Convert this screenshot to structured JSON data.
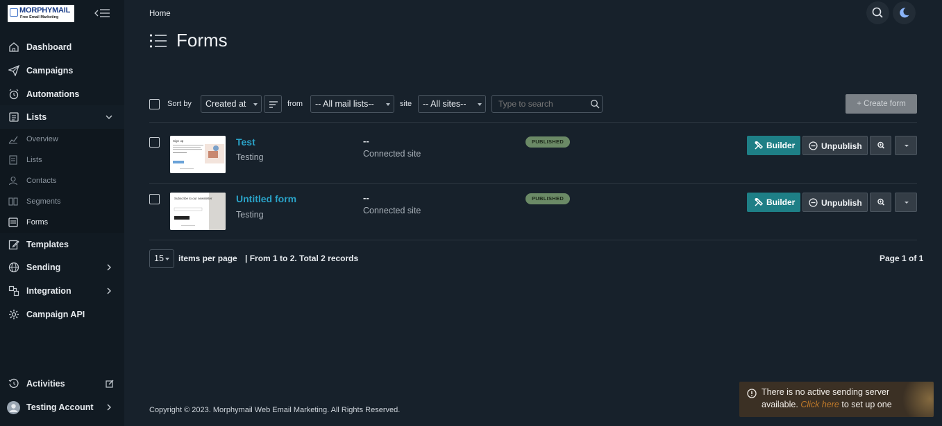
{
  "app": {
    "logo_title": "MORPHYMAIL",
    "logo_subtitle": "Free Email Marketing"
  },
  "sidebar": {
    "items": [
      {
        "label": "Dashboard",
        "icon": "home-icon"
      },
      {
        "label": "Campaigns",
        "icon": "paper-plane-icon"
      },
      {
        "label": "Automations",
        "icon": "alarm-clock-icon"
      },
      {
        "label": "Lists",
        "icon": "list-icon"
      },
      {
        "label": "Templates",
        "icon": "edit-icon"
      },
      {
        "label": "Sending",
        "icon": "globe-icon"
      },
      {
        "label": "Integration",
        "icon": "plug-icon"
      },
      {
        "label": "Campaign API",
        "icon": "gear-icon"
      }
    ],
    "lists_sub": [
      {
        "label": "Overview",
        "icon": "chart-icon"
      },
      {
        "label": "Lists",
        "icon": "list-icon"
      },
      {
        "label": "Contacts",
        "icon": "user-icon"
      },
      {
        "label": "Segments",
        "icon": "segments-icon"
      },
      {
        "label": "Forms",
        "icon": "form-icon",
        "active": true
      }
    ],
    "bottom": [
      {
        "label": "Activities",
        "icon": "history-icon"
      },
      {
        "label": "Testing Account",
        "icon": "avatar"
      }
    ]
  },
  "header": {
    "breadcrumb": "Home",
    "title": "Forms"
  },
  "toolbar": {
    "sort_by_label": "Sort by",
    "sort_value": "Created at",
    "from_label": "from",
    "mail_list_value": "-- All mail lists--",
    "site_label": "site",
    "site_value": "-- All sites--",
    "search_placeholder": "Type to search",
    "create_label": "+ Create form"
  },
  "forms": [
    {
      "name": "Test",
      "list": "Testing",
      "site": "--",
      "site_caption": "Connected site",
      "status": "PUBLISHED",
      "builder_label": "Builder",
      "unpublish_label": "Unpublish",
      "thumb_heading": "Sign up"
    },
    {
      "name": "Untitled form",
      "list": "Testing",
      "site": "--",
      "site_caption": "Connected site",
      "status": "PUBLISHED",
      "builder_label": "Builder",
      "unpublish_label": "Unpublish",
      "thumb_heading": "Subscribe to our newsletter"
    }
  ],
  "pagination": {
    "per_page": "15",
    "per_page_label": "items per page",
    "range_text": "| From 1 to 2. Total 2 records",
    "page_text": "Page 1 of 1"
  },
  "footer": {
    "copyright": "Copyright © 2023. Morphymail Web Email Marketing. All Rights Reserved."
  },
  "toast": {
    "line1": "There is no active sending server",
    "line2_prefix": "available.",
    "link_text": "Click here",
    "line2_suffix": "to set up one"
  },
  "colors": {
    "background": "#17212b",
    "sidebar": "#111a22",
    "accent": "#1e7f86",
    "link": "#2aa3c8",
    "badge": "#6b8a66"
  }
}
